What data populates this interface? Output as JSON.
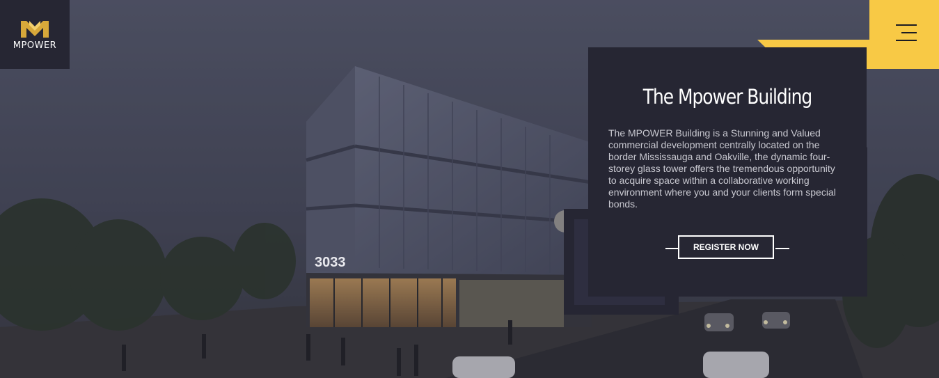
{
  "brand": {
    "logo_text": "MPOWER"
  },
  "hero": {
    "title": "The Mpower Building",
    "description": "The MPOWER Building is a Stunning and Valued commercial development centrally located on the border Mississauga and Oakville, the dynamic four-storey glass tower offers the tremendous opportunity to acquire space within a collaborative working environment where you and your clients form special bonds.",
    "register_label": "REGISTER NOW"
  },
  "building": {
    "address_number": "3033"
  },
  "nav": {
    "menu_icon": "hamburger-menu-icon"
  },
  "colors": {
    "accent": "#f8c945",
    "panel": "#262633",
    "text_light": "#ffffff",
    "text_muted": "#c9c9d1"
  }
}
